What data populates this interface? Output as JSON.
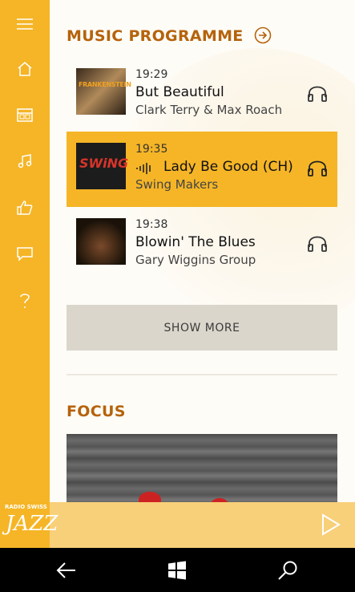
{
  "sidebar": {
    "items": [
      {
        "icon": "menu-icon"
      },
      {
        "icon": "home-icon"
      },
      {
        "icon": "calendar-icon"
      },
      {
        "icon": "music-note-icon"
      },
      {
        "icon": "thumbs-up-icon"
      },
      {
        "icon": "chat-icon"
      },
      {
        "icon": "help-icon"
      }
    ]
  },
  "music_programme": {
    "title": "MUSIC PROGRAMME",
    "tracks": [
      {
        "time": "19:29",
        "title": "But Beautiful",
        "artist": "Clark Terry & Max Roach",
        "cover_text": "FRANKENSTEIN",
        "active": false
      },
      {
        "time": "19:35",
        "title": "Lady Be Good (CH)",
        "artist": "Swing Makers",
        "cover_text": "SWiNG",
        "active": true
      },
      {
        "time": "19:38",
        "title": "Blowin' The Blues",
        "artist": "Gary Wiggins Group",
        "cover_text": "",
        "active": false
      }
    ],
    "show_more_label": "SHOW MORE"
  },
  "focus": {
    "title": "FOCUS"
  },
  "logo": {
    "top_text": "RADIO SWISS",
    "main_text": "JAZZ"
  },
  "colors": {
    "accent": "#f5b526",
    "title": "#b5630c",
    "player": "#f8d079"
  }
}
